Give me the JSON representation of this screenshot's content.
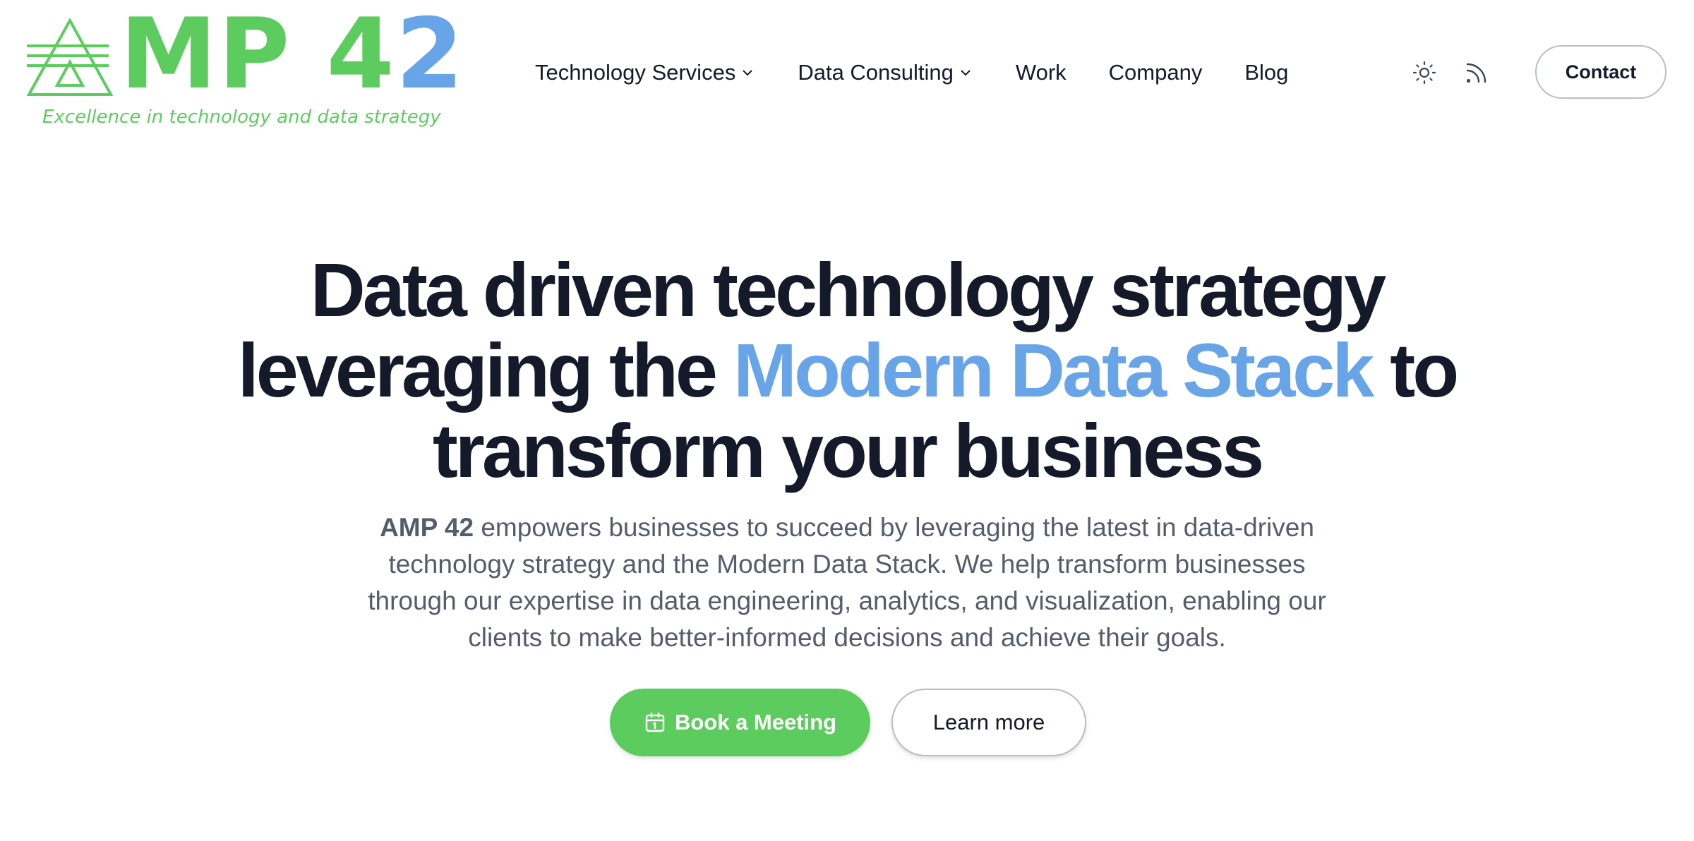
{
  "brand": {
    "logo_prefix": "MP",
    "logo_digit_green": "4",
    "logo_digit_blue": "2",
    "tagline": "Excellence in technology and data strategy",
    "green": "#5dcc5f",
    "blue": "#68a4e8",
    "logo_mark_icon": "triangle-lines-logo-icon"
  },
  "nav": {
    "items": [
      {
        "label": "Technology Services",
        "has_dropdown": true
      },
      {
        "label": "Data Consulting",
        "has_dropdown": true
      },
      {
        "label": "Work",
        "has_dropdown": false
      },
      {
        "label": "Company",
        "has_dropdown": false
      },
      {
        "label": "Blog",
        "has_dropdown": false
      }
    ],
    "dropdown_icon": "chevron-down-icon",
    "theme_icon": "sun-icon",
    "rss_icon": "rss-icon",
    "contact_label": "Contact"
  },
  "hero": {
    "title_line1": "Data driven technology strategy",
    "title_line2_before": "leveraging the",
    "title_accent": "Modern Data Stack",
    "title_line2_after": "to",
    "title_line3": "transform your business",
    "subtitle_brand": "AMP 42",
    "subtitle_text": "empowers businesses to succeed by leveraging the latest in data-driven technology strategy and the Modern Data Stack. We help transform businesses through our expertise in data engineering, analytics, and visualization, enabling our clients to make better-informed decisions and achieve their goals.",
    "primary_cta": "Book a Meeting",
    "primary_cta_icon": "calendar-icon",
    "secondary_cta": "Learn more",
    "title_color": "#141a29",
    "subtitle_color": "#545d6c"
  }
}
